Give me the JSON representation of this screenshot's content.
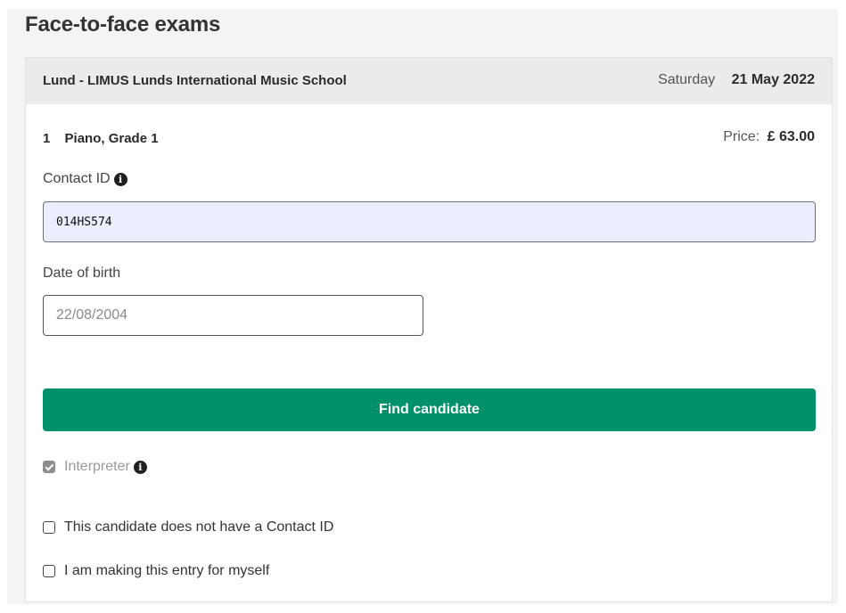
{
  "page": {
    "title": "Face-to-face exams"
  },
  "entry": {
    "venue": "Lund - LIMUS Lunds International Music School",
    "day": "Saturday",
    "date": "21 May 2022",
    "exam_number": "1",
    "exam_name": "Piano, Grade 1",
    "price_label": "Price:",
    "price_value": "£ 63.00"
  },
  "form": {
    "contact_id_label": "Contact ID",
    "contact_id_value": "014HS574",
    "dob_label": "Date of birth",
    "dob_placeholder": "22/08/2004",
    "find_button_label": "Find candidate",
    "interpreter_label": "Interpreter",
    "interpreter_checked": true,
    "interpreter_disabled": true,
    "no_contact_id_label": "This candidate does not have a Contact ID",
    "myself_label": "I am making this entry for myself"
  },
  "icons": {
    "info": "info-icon",
    "info_glyph": "i"
  },
  "colors": {
    "primary_button": "#00906a",
    "header_bg": "#edeaea",
    "autofill_bg": "#eaeefd"
  }
}
